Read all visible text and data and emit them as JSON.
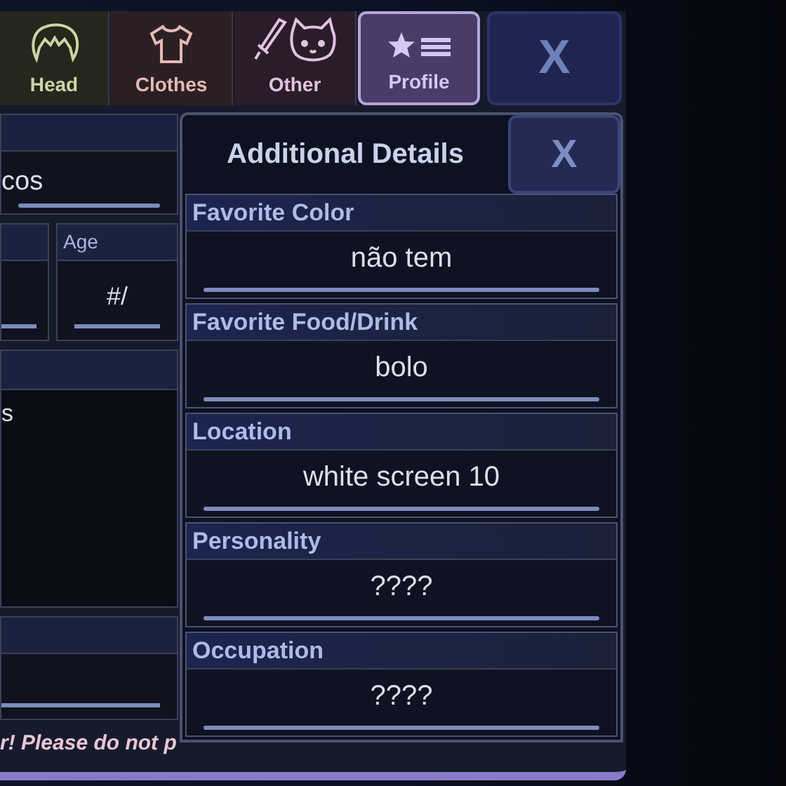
{
  "tabs": [
    {
      "label": "Head",
      "kind": "hair",
      "selected": false
    },
    {
      "label": "Clothes",
      "kind": "shirt",
      "selected": false
    },
    {
      "label": "Other",
      "kind": "other",
      "selected": false
    },
    {
      "label": "Profile",
      "kind": "profile",
      "selected": true
    }
  ],
  "close_label": "X",
  "form": {
    "name_value": "cos",
    "age_label": "Age",
    "age_value": "#/",
    "notes_value": "s"
  },
  "warning": "r! Please do not p",
  "details": {
    "title": "Additional Details",
    "close_label": "X",
    "fields": [
      {
        "label": "Favorite Color",
        "value": "não tem"
      },
      {
        "label": "Favorite Food/Drink",
        "value": "bolo"
      },
      {
        "label": "Location",
        "value": "white screen 10"
      },
      {
        "label": "Personality",
        "value": "????"
      },
      {
        "label": "Occupation",
        "value": "????"
      }
    ]
  }
}
